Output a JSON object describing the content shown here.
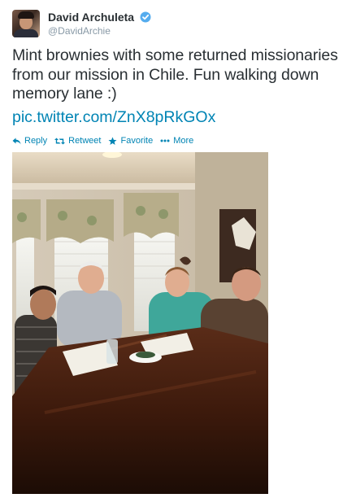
{
  "user": {
    "name": "David Archuleta",
    "handle": "@DavidArchie"
  },
  "tweet": {
    "text": "Mint brownies with some returned missionaries from our mission in Chile.  Fun walking down memory lane :)",
    "link": "pic.twitter.com/ZnX8pRkGOx"
  },
  "actions": {
    "reply": "Reply",
    "retweet": "Retweet",
    "favorite": "Favorite",
    "more": "More"
  },
  "colors": {
    "link": "#0084b4",
    "text": "#292f33",
    "muted": "#8899a6",
    "verified": "#55acee"
  }
}
